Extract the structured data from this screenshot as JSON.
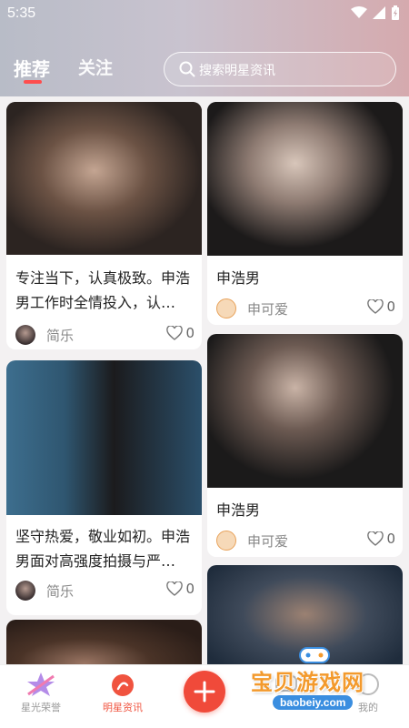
{
  "status_bar": {
    "time": "5:35"
  },
  "header": {
    "tabs": [
      {
        "label": "推荐",
        "active": true
      },
      {
        "label": "关注",
        "active": false
      }
    ],
    "search": {
      "placeholder": "搜索明星资讯"
    }
  },
  "feed": {
    "left": [
      {
        "title": "专注当下，认真极致。申浩男工作时全情投入，认…",
        "author": "简乐",
        "likes": "0"
      },
      {
        "title": "坚守热爱，敬业如初。申浩男面对高强度拍摄与严…",
        "author": "简乐",
        "likes": "0"
      }
    ],
    "right": [
      {
        "title": "申浩男",
        "author": "申可爱",
        "likes": "0"
      },
      {
        "title": "申浩男",
        "author": "申可爱",
        "likes": "0"
      }
    ]
  },
  "bottom_nav": {
    "items": [
      {
        "label": "星光荣誉",
        "icon": "star-icon"
      },
      {
        "label": "明星资讯",
        "icon": "news-icon",
        "active": true
      },
      {
        "label": "",
        "icon": "plus-icon"
      },
      {
        "label": "",
        "icon": "message-icon"
      },
      {
        "label": "我的",
        "icon": "profile-icon"
      }
    ]
  },
  "watermark": {
    "text": "宝贝游戏网",
    "url": "baobeiy.com"
  },
  "colors": {
    "accent": "#f04a3a",
    "indicator": "#ff4d4d",
    "text": "#222222",
    "muted": "#888888"
  }
}
